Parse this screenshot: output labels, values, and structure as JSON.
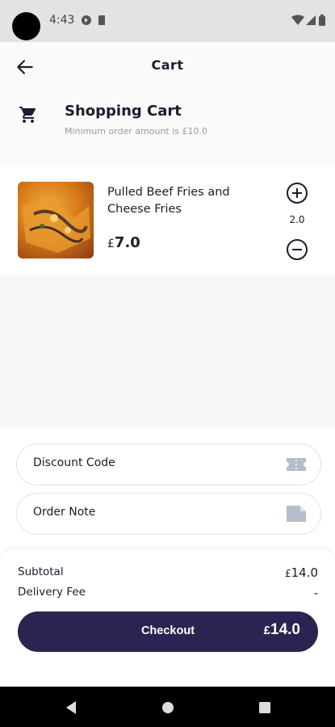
{
  "status_bar": {
    "time": "4:43"
  },
  "app_bar": {
    "title": "Cart"
  },
  "header": {
    "title": "Shopping Cart",
    "subtitle": "Minimum order amount is £10.0"
  },
  "cart_items": [
    {
      "name": "Pulled Beef Fries and Cheese Fries",
      "currency": "£",
      "price": "7.0",
      "quantity": "2.0"
    }
  ],
  "fields": {
    "discount_label": "Discount Code",
    "note_label": "Order Note"
  },
  "summary": {
    "subtotal_label": "Subtotal",
    "subtotal_currency": "£",
    "subtotal_value": "14.0",
    "delivery_label": "Delivery Fee",
    "delivery_value": "-"
  },
  "checkout": {
    "label": "Checkout",
    "currency": "£",
    "total": "14.0"
  },
  "colors": {
    "accent": "#2b2350",
    "background": "#f6f6f6",
    "muted_text": "#9a9aa6"
  }
}
